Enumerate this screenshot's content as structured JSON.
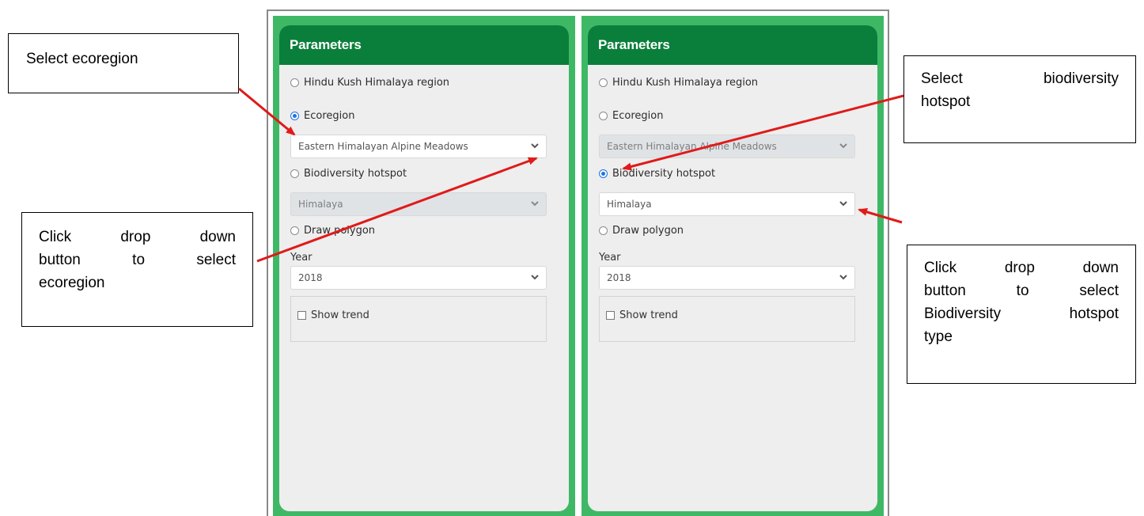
{
  "panels": [
    {
      "title": "Parameters",
      "options": {
        "hkh": {
          "label": "Hindu Kush Himalaya region",
          "checked": false
        },
        "ecoregion": {
          "label": "Ecoregion",
          "checked": true
        },
        "hotspot": {
          "label": "Biodiversity hotspot",
          "checked": false
        },
        "polygon": {
          "label": "Draw polygon",
          "checked": false
        }
      },
      "ecoregion_select": {
        "value": "Eastern Himalayan Alpine Meadows",
        "enabled": true
      },
      "hotspot_select": {
        "value": "Himalaya",
        "enabled": false
      },
      "year_label": "Year",
      "year_select": {
        "value": "2018"
      },
      "show_trend": {
        "label": "Show trend",
        "checked": false
      }
    },
    {
      "title": "Parameters",
      "options": {
        "hkh": {
          "label": "Hindu Kush Himalaya region",
          "checked": false
        },
        "ecoregion": {
          "label": "Ecoregion",
          "checked": false
        },
        "hotspot": {
          "label": "Biodiversity hotspot",
          "checked": true
        },
        "polygon": {
          "label": "Draw polygon",
          "checked": false
        }
      },
      "ecoregion_select": {
        "value": "Eastern Himalayan Alpine Meadows",
        "enabled": false
      },
      "hotspot_select": {
        "value": "Himalaya",
        "enabled": true
      },
      "year_label": "Year",
      "year_select": {
        "value": "2018"
      },
      "show_trend": {
        "label": "Show trend",
        "checked": false
      }
    }
  ],
  "callouts": {
    "select_ecoregion": [
      "Select ecoregion"
    ],
    "click_dropdown_ecoregion": [
      "Click drop down",
      "button to select",
      "ecoregion"
    ],
    "select_hotspot": [
      "Select biodiversity",
      "hotspot"
    ],
    "click_dropdown_hotspot": [
      "Click drop down",
      "button to select",
      "Biodiversity hotspot",
      "type"
    ]
  },
  "colors": {
    "panel_border": "#3fb866",
    "header": "#0a7f3b",
    "arrow": "#e01a1a",
    "radio_selected": "#1e73e6"
  },
  "icons": {
    "dropdown": "chevron-down-icon",
    "radio": "radio-button-icon",
    "checkbox": "checkbox-icon"
  }
}
